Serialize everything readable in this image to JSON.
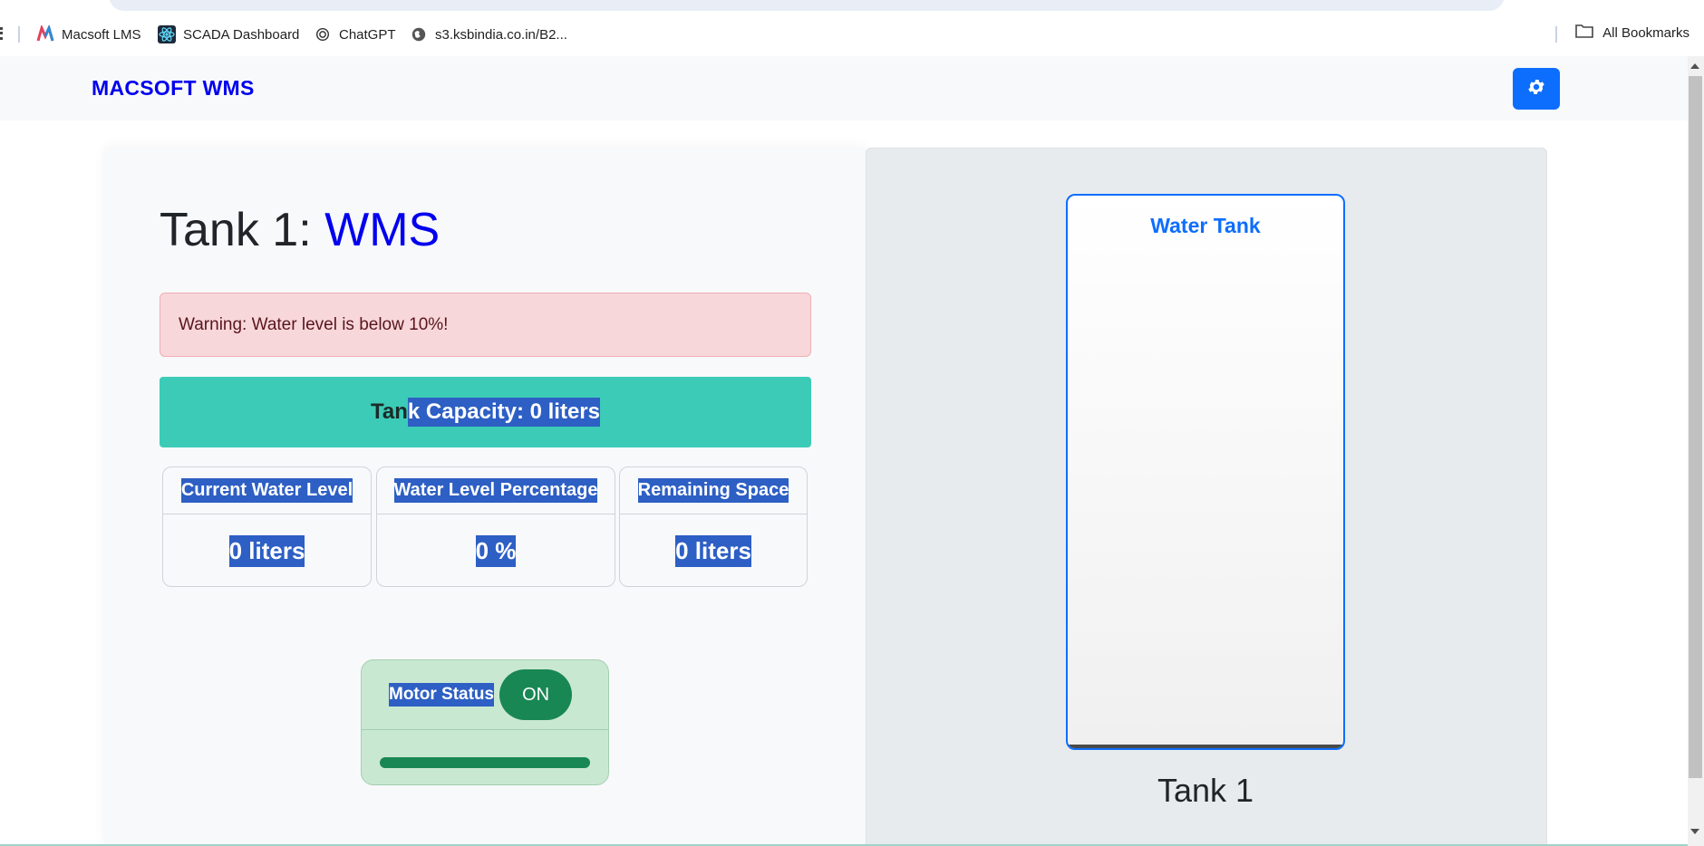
{
  "browser": {
    "bookmarks": [
      {
        "label": "Macsoft LMS",
        "icon": "macsoft-icon"
      },
      {
        "label": "SCADA Dashboard",
        "icon": "react-icon"
      },
      {
        "label": "ChatGPT",
        "icon": "chatgpt-icon"
      },
      {
        "label": "s3.ksbindia.co.in/B2...",
        "icon": "globe-icon"
      }
    ],
    "all_bookmarks": "All Bookmarks"
  },
  "navbar": {
    "brand": "MACSOFT WMS",
    "settings_icon": "gear-icon",
    "accent_color": "#0d6efd"
  },
  "main": {
    "title_prefix": "Tank 1:",
    "title_accent": "WMS",
    "alert": "Warning: Water level is below 10%!",
    "capacity_part1": "Tan",
    "capacity_part2": "k Capacity: 0 liters",
    "stats": [
      {
        "label": "Current Water Level",
        "value": "0 liters"
      },
      {
        "label": "Water Level Percentage",
        "value": "0 %"
      },
      {
        "label": "Remaining Space",
        "value": "0 liters"
      }
    ],
    "motor": {
      "label": "Motor Status",
      "state": "ON",
      "progress": 1.0
    }
  },
  "tank": {
    "title": "Water Tank",
    "name": "Tank 1",
    "fill_percent": 0
  },
  "colors": {
    "capacity_bg": "#3ccbb7",
    "alert_bg": "#f8d7da",
    "motor_on": "#198754",
    "selection": "#2d5fc4"
  }
}
